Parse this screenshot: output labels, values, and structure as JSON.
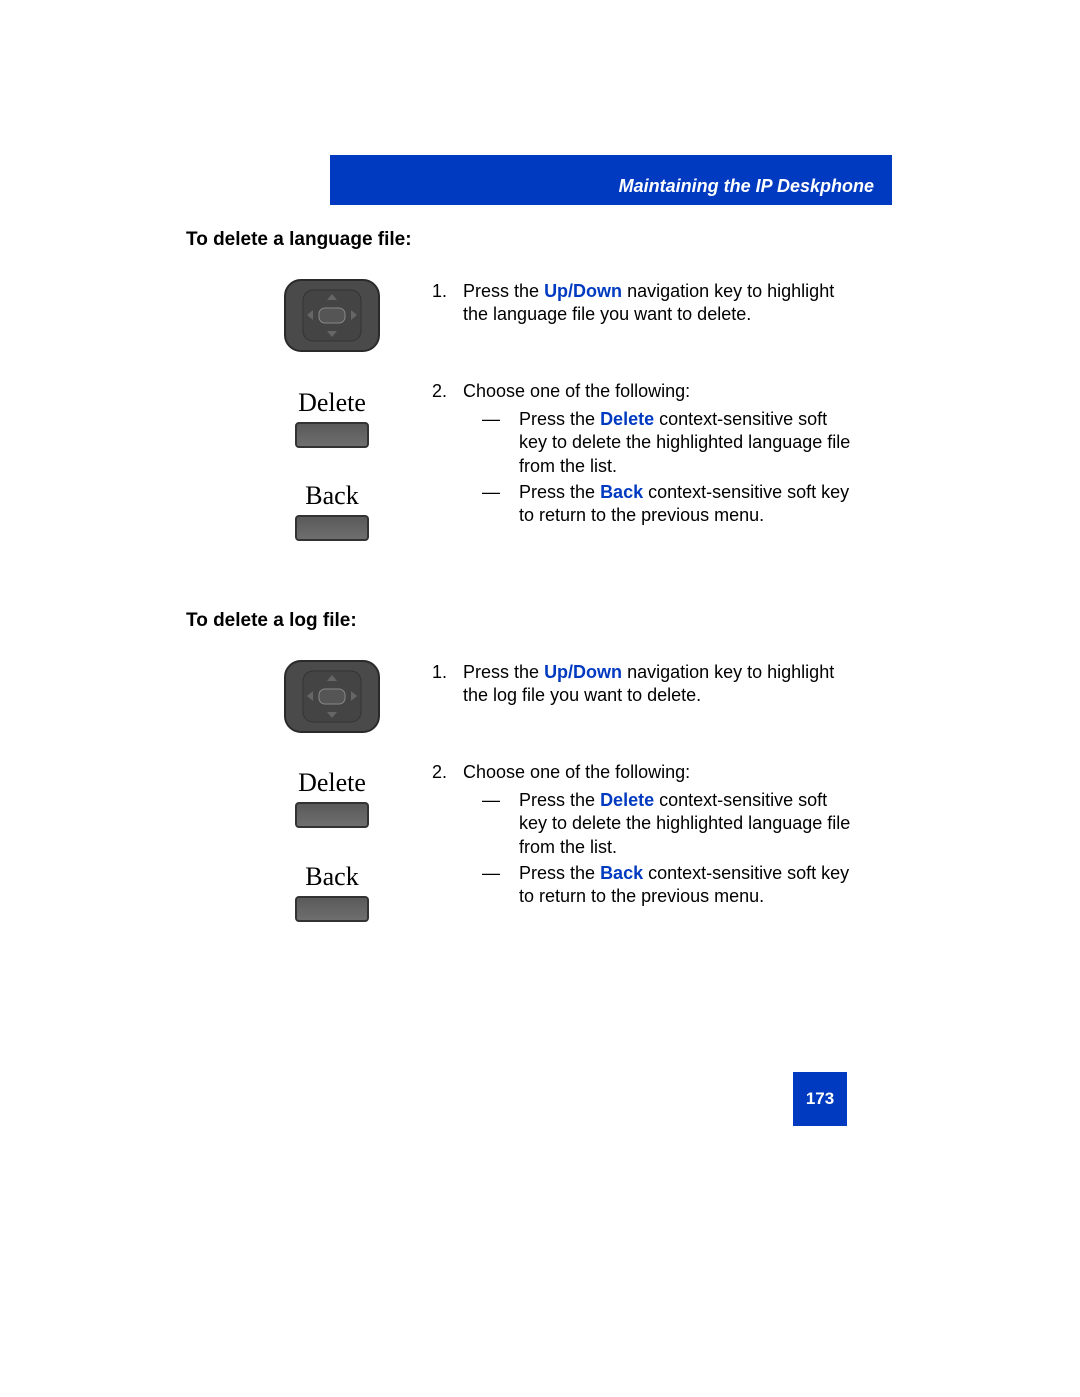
{
  "header": {
    "title": "Maintaining the IP Deskphone"
  },
  "section1": {
    "heading": "To delete a language file:",
    "softkeys": {
      "delete": "Delete",
      "back": "Back"
    },
    "step1": {
      "num": "1.",
      "pre": "Press the ",
      "hl": "Up/Down",
      "post": " navigation key to highlight the language file you want to delete."
    },
    "step2": {
      "num": "2.",
      "text": "Choose one of the following:"
    },
    "sub_a": {
      "pre": "Press the ",
      "hl": "Delete",
      "post": " context-sensitive soft key to delete the highlighted language file from the list."
    },
    "sub_b": {
      "pre": "Press the ",
      "hl": "Back",
      "post": " context-sensitive soft key to return to the previous menu."
    }
  },
  "section2": {
    "heading": "To delete a log file:",
    "softkeys": {
      "delete": "Delete",
      "back": "Back"
    },
    "step1": {
      "num": "1.",
      "pre": "Press the ",
      "hl": "Up/Down",
      "post": " navigation key to highlight the log file you want to delete."
    },
    "step2": {
      "num": "2.",
      "text": "Choose one of the following:"
    },
    "sub_a": {
      "pre": "Press the ",
      "hl": "Delete",
      "post": " context-sensitive soft key to delete the highlighted language file from the list."
    },
    "sub_b": {
      "pre": "Press the ",
      "hl": "Back",
      "post": " context-sensitive soft key to return to the previous menu."
    }
  },
  "page_number": "173",
  "dash": "—"
}
